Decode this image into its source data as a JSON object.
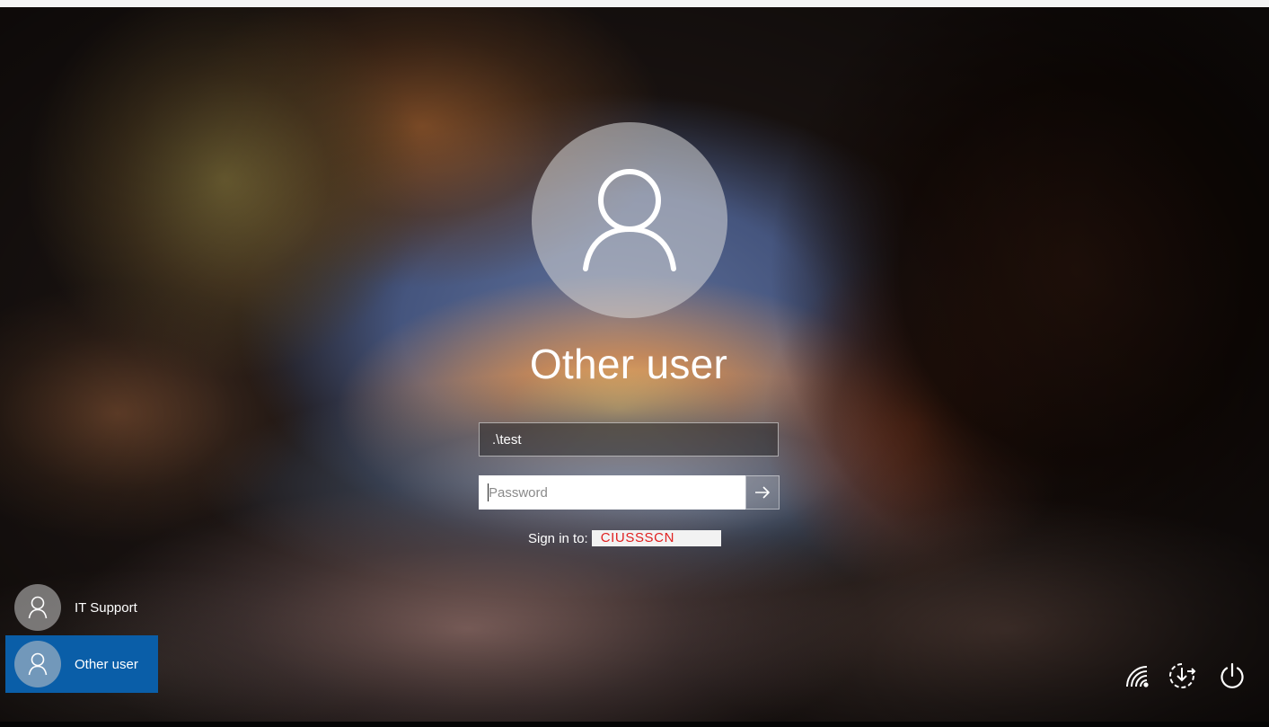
{
  "screen": {
    "kind": "windows-lock-screen"
  },
  "login": {
    "avatar_icon": "person-icon",
    "display_name": "Other user",
    "username_value": ".\\test",
    "password_placeholder": "Password",
    "password_value": "",
    "submit_icon": "arrow-right-icon",
    "signin_label": "Sign in to:",
    "signin_domain": "CIUSSSCN"
  },
  "user_list": [
    {
      "name": "IT Support",
      "icon": "person-icon",
      "selected": false
    },
    {
      "name": "Other user",
      "icon": "person-icon",
      "selected": true
    }
  ],
  "system_buttons": [
    {
      "name": "network",
      "icon": "wifi-icon"
    },
    {
      "name": "ease-of-access",
      "icon": "ease-of-access-icon"
    },
    {
      "name": "power",
      "icon": "power-icon"
    }
  ],
  "colors": {
    "selected_tile": "#0a5ea8",
    "domain_text": "#e02020",
    "text": "#ffffff"
  }
}
